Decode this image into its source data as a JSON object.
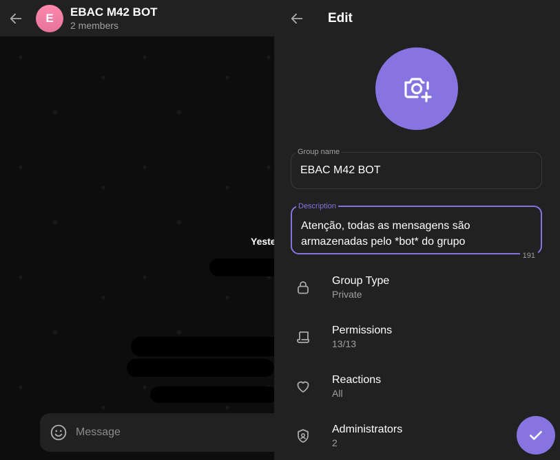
{
  "chat": {
    "title": "EBAC M42 BOT",
    "members": "2 members",
    "avatar_letter": "E",
    "date_chip": "Yeste",
    "composer_placeholder": "Message"
  },
  "edit": {
    "title": "Edit",
    "group_name_label": "Group name",
    "group_name_value": "EBAC M42 BOT",
    "description_label": "Description",
    "description_value": "Atenção, todas as mensagens são armazenadas pelo *bot* do grupo",
    "description_counter": "191",
    "settings": [
      {
        "label": "Group Type",
        "value": "Private",
        "icon": "lock-icon"
      },
      {
        "label": "Permissions",
        "value": "13/13",
        "icon": "permissions-icon"
      },
      {
        "label": "Reactions",
        "value": "All",
        "icon": "heart-icon"
      },
      {
        "label": "Administrators",
        "value": "2",
        "icon": "shield-icon"
      }
    ]
  },
  "colors": {
    "accent": "#8774e1",
    "panel": "#212121",
    "avatar": "#ff89ad"
  }
}
